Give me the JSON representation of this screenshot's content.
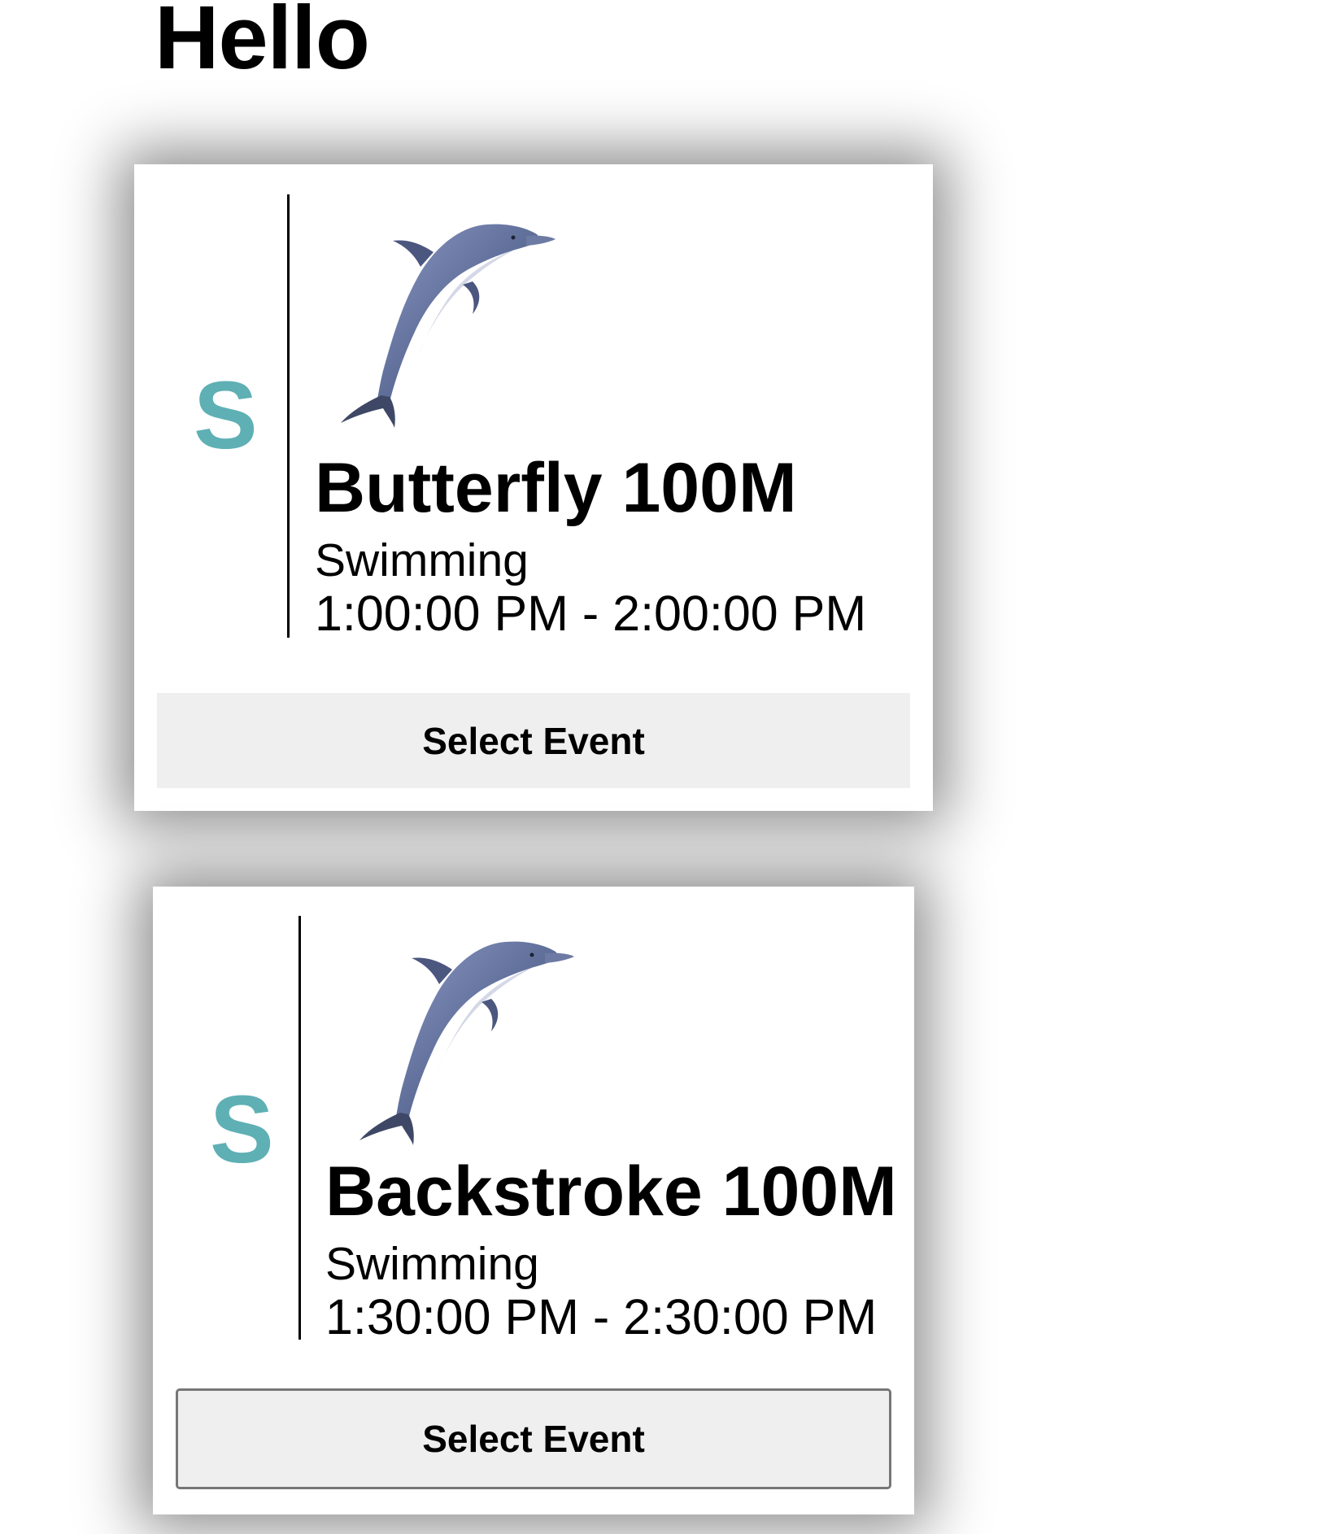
{
  "page": {
    "title": "Hello"
  },
  "events": [
    {
      "letter": "S",
      "title": "Butterfly 100M",
      "sport": "Swimming",
      "time": "1:00:00 PM - 2:00:00 PM",
      "button_label": "Select Event",
      "icon": "dolphin-icon"
    },
    {
      "letter": "S",
      "title": "Backstroke 100M",
      "sport": "Swimming",
      "time": "1:30:00 PM - 2:30:00 PM",
      "button_label": "Select Event",
      "icon": "dolphin-icon"
    }
  ],
  "colors": {
    "letter_accent": "#5eb0b4",
    "button_bg": "#efefef",
    "dolphin_body": "#6a7aa6"
  }
}
